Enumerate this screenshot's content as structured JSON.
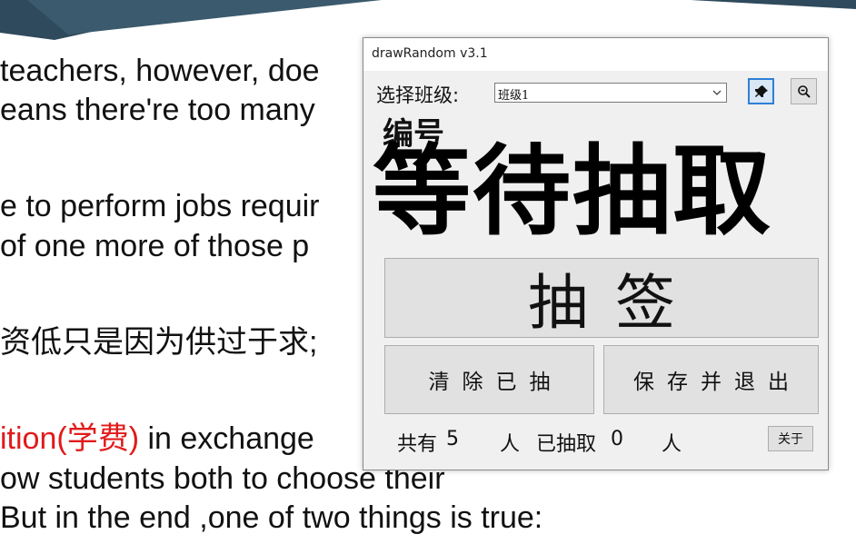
{
  "slide": {
    "line1": "teachers, however, doe",
    "line2": "eans there're too many",
    "line3": "e to perform jobs requir",
    "line4": "of one more of those p",
    "line5": "资低只是因为供过于求;",
    "line6_red": "ition(学费)",
    "line6_rest": " in exchange",
    "line7": "ow students both to choose their",
    "line8": "But in the end ,one of two things is true:",
    "highlight_color": "#e01b1b",
    "banner_color": "#2f4a5c"
  },
  "window": {
    "title": "drawRandom v3.1",
    "class_label": "选择班级:",
    "class_selected": "班级1",
    "pin_icon": "pin-icon",
    "zoom_icon": "zoom-out-icon",
    "number_label": "编号",
    "result": "等待抽取",
    "draw_button": "抽签",
    "clear_button": "清除已抽",
    "save_button": "保存并退出",
    "total_prefix": "共有",
    "total_count": "5",
    "total_suffix": "人",
    "drawn_prefix": "已抽取",
    "drawn_count": "0",
    "drawn_suffix": "人",
    "about_button": "关于",
    "accent_color": "#2f7fd6"
  }
}
